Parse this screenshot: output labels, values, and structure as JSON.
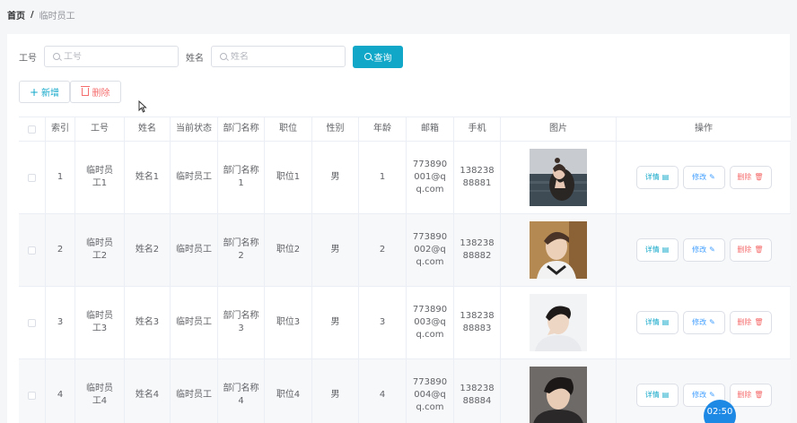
{
  "breadcrumb": {
    "home": "首页",
    "separator": "/",
    "current": "临时员工"
  },
  "search": {
    "id_label": "工号",
    "id_placeholder": "工号",
    "name_label": "姓名",
    "name_placeholder": "姓名",
    "query_label": "查询"
  },
  "actions": {
    "add_label": "新增",
    "delete_label": "删除"
  },
  "table": {
    "headers": [
      "索引",
      "工号",
      "姓名",
      "当前状态",
      "部门名称",
      "职位",
      "性别",
      "年龄",
      "邮箱",
      "手机",
      "图片",
      "操作"
    ],
    "rows": [
      {
        "index": "1",
        "id": "临时员工1",
        "name": "姓名1",
        "status": "临时员工",
        "dept": "部门名称1",
        "position": "职位1",
        "gender": "男",
        "age": "1",
        "email": "773890001@qq.com",
        "phone": "13823888881",
        "photo": "photo-woman-seaside"
      },
      {
        "index": "2",
        "id": "临时员工2",
        "name": "姓名2",
        "status": "临时员工",
        "dept": "部门名称2",
        "position": "职位2",
        "gender": "男",
        "age": "2",
        "email": "773890002@qq.com",
        "phone": "13823888882",
        "photo": "photo-man-1"
      },
      {
        "index": "3",
        "id": "临时员工3",
        "name": "姓名3",
        "status": "临时员工",
        "dept": "部门名称3",
        "position": "职位3",
        "gender": "男",
        "age": "3",
        "email": "773890003@qq.com",
        "phone": "13823888883",
        "photo": "photo-man-2"
      },
      {
        "index": "4",
        "id": "临时员工4",
        "name": "姓名4",
        "status": "临时员工",
        "dept": "部门名称4",
        "position": "职位4",
        "gender": "男",
        "age": "4",
        "email": "773890004@qq.com",
        "phone": "13823888884",
        "photo": "photo-man-3"
      }
    ],
    "row_actions": {
      "detail": "详情",
      "edit": "修改",
      "remove": "删除"
    }
  },
  "timer": "02:50",
  "colors": {
    "primary": "#11a7c9",
    "danger": "#f56c6c",
    "edit": "#409eff",
    "timer_bg": "#1e88e5"
  }
}
